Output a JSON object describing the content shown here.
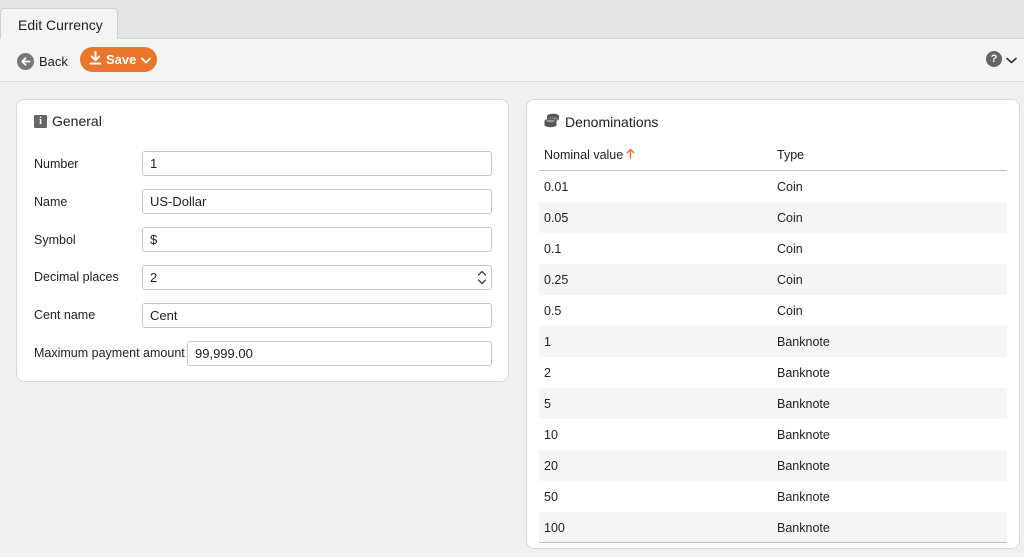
{
  "tab": {
    "title": "Edit Currency"
  },
  "toolbar": {
    "back_label": "Back",
    "save_label": "Save"
  },
  "general": {
    "title": "General",
    "fields": {
      "number": {
        "label": "Number",
        "value": "1"
      },
      "name": {
        "label": "Name",
        "value": "US-Dollar"
      },
      "symbol": {
        "label": "Symbol",
        "value": "$"
      },
      "decimal_places": {
        "label": "Decimal places",
        "value": "2"
      },
      "cent_name": {
        "label": "Cent name",
        "value": "Cent"
      },
      "max_payment": {
        "label": "Maximum payment amount",
        "value": "99,999.00"
      }
    }
  },
  "denominations": {
    "title": "Denominations",
    "columns": {
      "nominal": "Nominal value",
      "type": "Type"
    },
    "rows": [
      {
        "value": "0.01",
        "type": "Coin"
      },
      {
        "value": "0.05",
        "type": "Coin"
      },
      {
        "value": "0.1",
        "type": "Coin"
      },
      {
        "value": "0.25",
        "type": "Coin"
      },
      {
        "value": "0.5",
        "type": "Coin"
      },
      {
        "value": "1",
        "type": "Banknote"
      },
      {
        "value": "2",
        "type": "Banknote"
      },
      {
        "value": "5",
        "type": "Banknote"
      },
      {
        "value": "10",
        "type": "Banknote"
      },
      {
        "value": "20",
        "type": "Banknote"
      },
      {
        "value": "50",
        "type": "Banknote"
      },
      {
        "value": "100",
        "type": "Banknote"
      }
    ]
  },
  "colors": {
    "accent": "#e8762c",
    "icon_gray": "#666666"
  },
  "icons": {
    "back": "arrow-left-circle-icon",
    "save": "download-arrow-icon",
    "help": "question-circle-icon",
    "general": "info-icon",
    "denominations": "coins-stack-icon",
    "sort": "sort-ascending-arrow-icon"
  }
}
